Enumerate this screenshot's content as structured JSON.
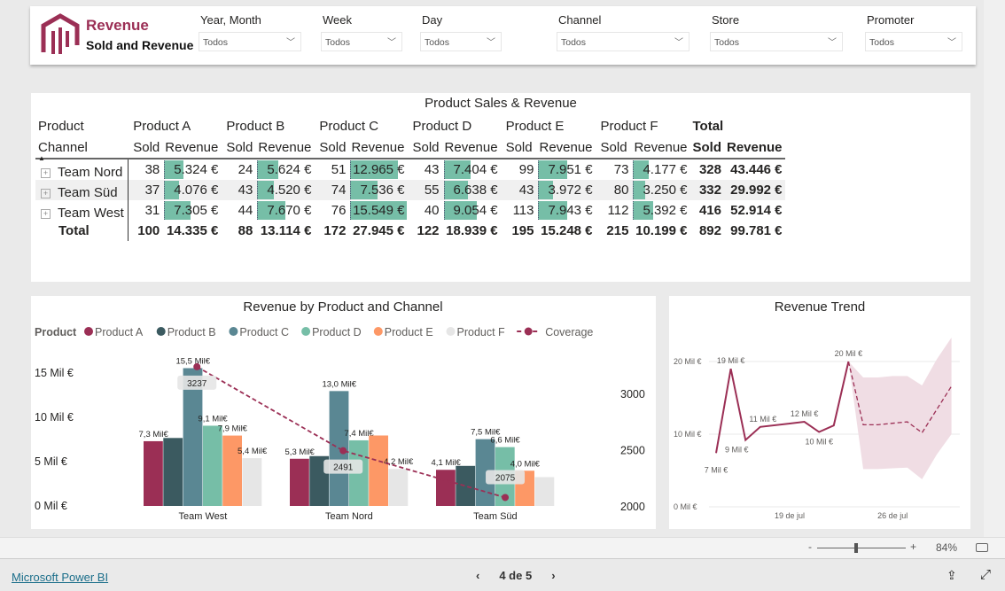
{
  "header": {
    "title": "Revenue",
    "subtitle": "Sold and Revenue",
    "logo": "building-bars-logo",
    "brand_color": "#9b2f55"
  },
  "slicers": [
    {
      "label": "Year, Month",
      "value": "Todos"
    },
    {
      "label": "Week",
      "value": "Todos"
    },
    {
      "label": "Day",
      "value": "Todos"
    },
    {
      "label": "Channel",
      "value": "Todos"
    },
    {
      "label": "Store",
      "value": "Todos"
    },
    {
      "label": "Promoter",
      "value": "Todos"
    }
  ],
  "matrix": {
    "title": "Product Sales & Revenue",
    "row_header_1": "Product",
    "row_header_2": "Channel",
    "sort": "ascending",
    "products": [
      "Product A",
      "Product B",
      "Product C",
      "Product D",
      "Product E",
      "Product F"
    ],
    "total_label": "Total",
    "sold_label": "Sold",
    "revenue_label": "Revenue",
    "bar_color": "#76bea7",
    "rows": [
      {
        "channel": "Team Nord",
        "sold": [
          38,
          24,
          51,
          43,
          99,
          73
        ],
        "revenue": [
          5324,
          5624,
          12965,
          7404,
          7951,
          4177
        ],
        "revenue_text": [
          "5.324 €",
          "5.624 €",
          "12.965 €",
          "7.404 €",
          "7.951 €",
          "4.177 €"
        ],
        "total_sold": "328",
        "total_revenue": "43.446 €"
      },
      {
        "channel": "Team Süd",
        "sold": [
          37,
          43,
          74,
          55,
          43,
          80
        ],
        "revenue": [
          4076,
          4520,
          7536,
          6638,
          3972,
          3250
        ],
        "revenue_text": [
          "4.076 €",
          "4.520 €",
          "7.536 €",
          "6.638 €",
          "3.972 €",
          "3.250 €"
        ],
        "total_sold": "332",
        "total_revenue": "29.992 €"
      },
      {
        "channel": "Team West",
        "sold": [
          31,
          44,
          76,
          40,
          113,
          112
        ],
        "revenue": [
          7305,
          7670,
          15549,
          9054,
          7943,
          5392
        ],
        "revenue_text": [
          "7.305 €",
          "7.670 €",
          "15.549 €",
          "9.054 €",
          "7.943 €",
          "5.392 €"
        ],
        "total_sold": "416",
        "total_revenue": "52.914 €"
      }
    ],
    "totals": {
      "sold": [
        "100",
        "88",
        "172",
        "122",
        "195",
        "215"
      ],
      "revenue": [
        "14.335 €",
        "13.114 €",
        "27.945 €",
        "18.939 €",
        "15.248 €",
        "10.199 €"
      ],
      "total_sold": "892",
      "total_revenue": "99.781 €"
    }
  },
  "chart_data": [
    {
      "type": "bar",
      "title": "Revenue by Product and Channel",
      "legend_title": "Product",
      "legend_placement": "top-left",
      "categories": [
        "Team West",
        "Team Nord",
        "Team Süd"
      ],
      "y_ticks": [
        "0 Mil €",
        "5 Mil €",
        "10 Mil €",
        "15 Mil €"
      ],
      "ylim": [
        0,
        15
      ],
      "y2_ticks": [
        "2000",
        "2500",
        "3000"
      ],
      "y2lim": [
        2000,
        3000
      ],
      "series": [
        {
          "name": "Product A",
          "color": "#9b2f55",
          "values": [
            7.305,
            5.324,
            4.076
          ],
          "labels": [
            "7,3 Mil€",
            "5,3 Mil€",
            "4,1 Mil€"
          ]
        },
        {
          "name": "Product B",
          "color": "#3b5a60",
          "values": [
            7.67,
            5.624,
            4.52
          ],
          "labels": [
            "",
            "",
            ""
          ]
        },
        {
          "name": "Product C",
          "color": "#5a8793",
          "values": [
            15.549,
            12.965,
            7.536
          ],
          "labels": [
            "15,5 Mil€",
            "13,0 Mil€",
            "7,5 Mil€"
          ]
        },
        {
          "name": "Product D",
          "color": "#76bea7",
          "values": [
            9.054,
            7.404,
            6.638
          ],
          "labels": [
            "9,1 Mil€",
            "7,4 Mil€",
            "6,6 Mil€"
          ]
        },
        {
          "name": "Product E",
          "color": "#fd9866",
          "values": [
            7.943,
            7.951,
            3.972
          ],
          "labels": [
            "7,9 Mil€",
            "",
            "4,0 Mil€"
          ]
        },
        {
          "name": "Product F",
          "color": "#e6e6e6",
          "values": [
            5.392,
            4.177,
            3.25
          ],
          "labels": [
            "5,4 Mil€",
            "4,2 Mil€",
            ""
          ]
        }
      ],
      "line": {
        "name": "Coverage",
        "color": "#9b2f55",
        "values": [
          3237,
          2491,
          2075
        ],
        "labels": [
          "3237",
          "2491",
          "2075"
        ]
      }
    },
    {
      "type": "line",
      "title": "Revenue Trend",
      "y_ticks": [
        "0 Mil €",
        "10 Mil €",
        "20 Mil €"
      ],
      "ylim": [
        0,
        20
      ],
      "grid": true,
      "x_ticks": [
        "19 de jul",
        "26 de jul"
      ],
      "actual": {
        "dates": [
          "14 jul",
          "15 jul",
          "16 jul",
          "17 jul",
          "20 jul",
          "21 jul",
          "22 jul",
          "23 jul"
        ],
        "values": [
          7.4,
          19,
          9.2,
          11,
          11.7,
          10.3,
          11.2,
          20
        ],
        "labels": [
          "7 Mil €",
          "19 Mil €",
          "9 Mil €",
          "11 Mil €",
          "12 Mil €",
          "10 Mil €",
          "",
          "20 Mil €"
        ]
      },
      "forecast": {
        "dates": [
          "23 jul",
          "24 jul",
          "25 jul",
          "26 jul",
          "27 jul",
          "28 jul",
          "29 jul",
          "30 jul"
        ],
        "values": [
          20,
          11.3,
          11.3,
          11.5,
          11.7,
          10.2,
          13.4,
          16.6
        ],
        "upper": [
          20,
          17.8,
          17.8,
          18,
          18,
          16.7,
          20.3,
          23.3
        ],
        "lower": [
          20,
          5.2,
          5.2,
          5.3,
          5.4,
          3.8,
          7.2,
          10
        ]
      },
      "line_color": "#9b2f55",
      "band_color": "#f0dde4"
    }
  ],
  "status": {
    "zoom_minus": "-",
    "zoom_plus": "+",
    "zoom_level": "84%",
    "zoom_fraction": 0.42
  },
  "footer": {
    "brand_link": "Microsoft Power BI",
    "page": "4 de 5",
    "prev": "‹",
    "next": "›"
  }
}
